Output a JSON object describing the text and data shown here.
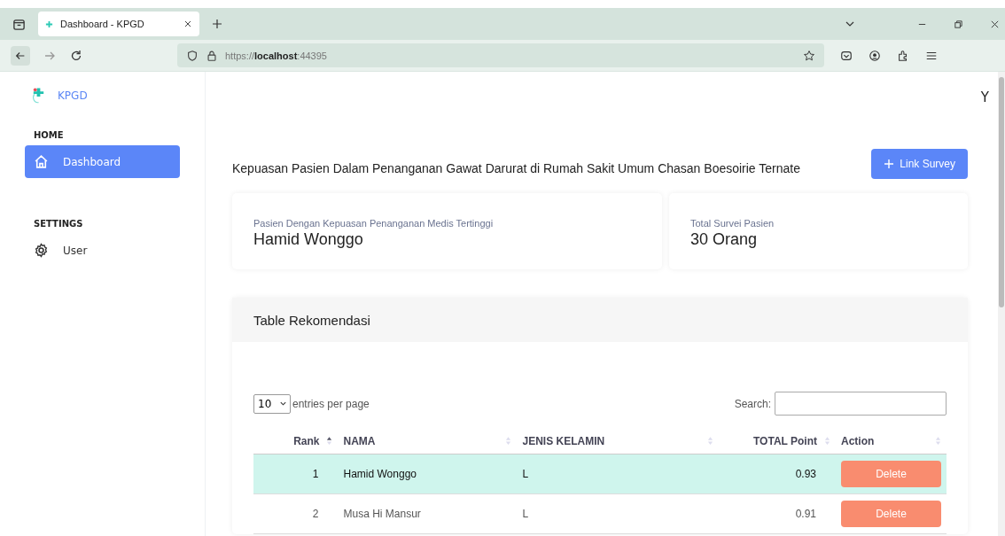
{
  "browser": {
    "tab_title": "Dashboard - KPGD",
    "url_scheme": "https://",
    "url_host": "localhost",
    "url_port": ":44395"
  },
  "sidebar": {
    "brand": "KPGD",
    "sections": [
      {
        "title": "HOME",
        "items": [
          {
            "label": "Dashboard",
            "selected": true
          }
        ]
      },
      {
        "title": "SETTINGS",
        "items": [
          {
            "label": "User",
            "selected": false
          }
        ]
      }
    ]
  },
  "user_initial": "Y",
  "page_title": "Kepuasan Pasien Dalam Penanganan Gawat Darurat di Rumah Sakit Umum Chasan Boesoirie Ternate",
  "link_button": "Link Survey",
  "stats": [
    {
      "label": "Pasien Dengan Kepuasan Penanganan Medis Tertinggi",
      "value": "Hamid Wonggo"
    },
    {
      "label": "Total Survei Pasien",
      "value": "30 Orang"
    }
  ],
  "table": {
    "title": "Table Rekomendasi",
    "page_size": "10",
    "page_size_label": "entries per page",
    "search_label": "Search:",
    "columns": [
      {
        "label": "Rank",
        "sorted": true
      },
      {
        "label": "NAMA",
        "sorted": false
      },
      {
        "label": "JENIS KELAMIN",
        "sorted": false
      },
      {
        "label": "TOTAL Point",
        "sorted": false
      },
      {
        "label": "Action",
        "sorted": false
      }
    ],
    "rows": [
      {
        "cells": [
          "1",
          "Hamid Wonggo",
          "L",
          "0.93"
        ],
        "action": "Delete",
        "selected": true
      },
      {
        "cells": [
          "2",
          "Musa Hi Mansur",
          "L",
          "0.91"
        ],
        "action": "Delete",
        "selected": false
      }
    ]
  }
}
